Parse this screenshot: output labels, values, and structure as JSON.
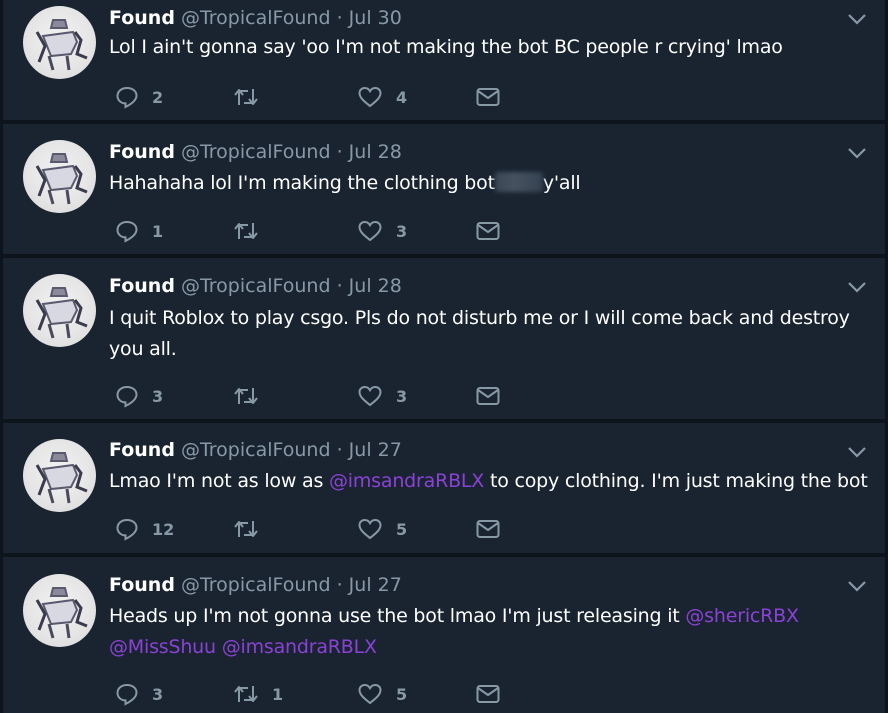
{
  "tweets": [
    {
      "name": "Found",
      "handle": "@TropicalFound",
      "separator": "·",
      "date": "Jul 30",
      "text_parts": [
        "Lol I ain't gonna say 'oo I'm not making the bot BC people r crying' lmao"
      ],
      "replies": "2",
      "retweets": "",
      "likes": "4"
    },
    {
      "name": "Found",
      "handle": "@TropicalFound",
      "separator": "·",
      "date": "Jul 28",
      "text_parts": [
        "Hahahaha lol I'm making the clothing bot",
        "y'all"
      ],
      "replies": "1",
      "retweets": "",
      "likes": "3"
    },
    {
      "name": "Found",
      "handle": "@TropicalFound",
      "separator": "·",
      "date": "Jul 28",
      "text_parts": [
        "I quit Roblox to play csgo. Pls do not disturb me or I will come back and destroy you all."
      ],
      "replies": "3",
      "retweets": "",
      "likes": "3"
    },
    {
      "name": "Found",
      "handle": "@TropicalFound",
      "separator": "·",
      "date": "Jul 27",
      "text_parts": [
        "Lmao I'm not as low as ",
        "@imsandraRBLX",
        " to copy clothing. I'm just making the bot"
      ],
      "replies": "12",
      "retweets": "",
      "likes": "5"
    },
    {
      "name": "Found",
      "handle": "@TropicalFound",
      "separator": "·",
      "date": "Jul 27",
      "text_parts": [
        "Heads up I'm not gonna use the bot lmao I'm just releasing it ",
        "@shericRBX",
        "@MissShuu",
        "@imsandraRBLX"
      ],
      "replies": "3",
      "retweets": "1",
      "likes": "5"
    }
  ],
  "icons": {
    "reply": "reply-icon",
    "retweet": "retweet-icon",
    "like": "heart-icon",
    "dm": "envelope-icon",
    "caret": "chevron-down-icon"
  },
  "colors": {
    "background": "#0d141c",
    "card": "#1a2431",
    "text": "#ffffff",
    "muted": "#8899a6",
    "mention": "#8a42d6"
  }
}
